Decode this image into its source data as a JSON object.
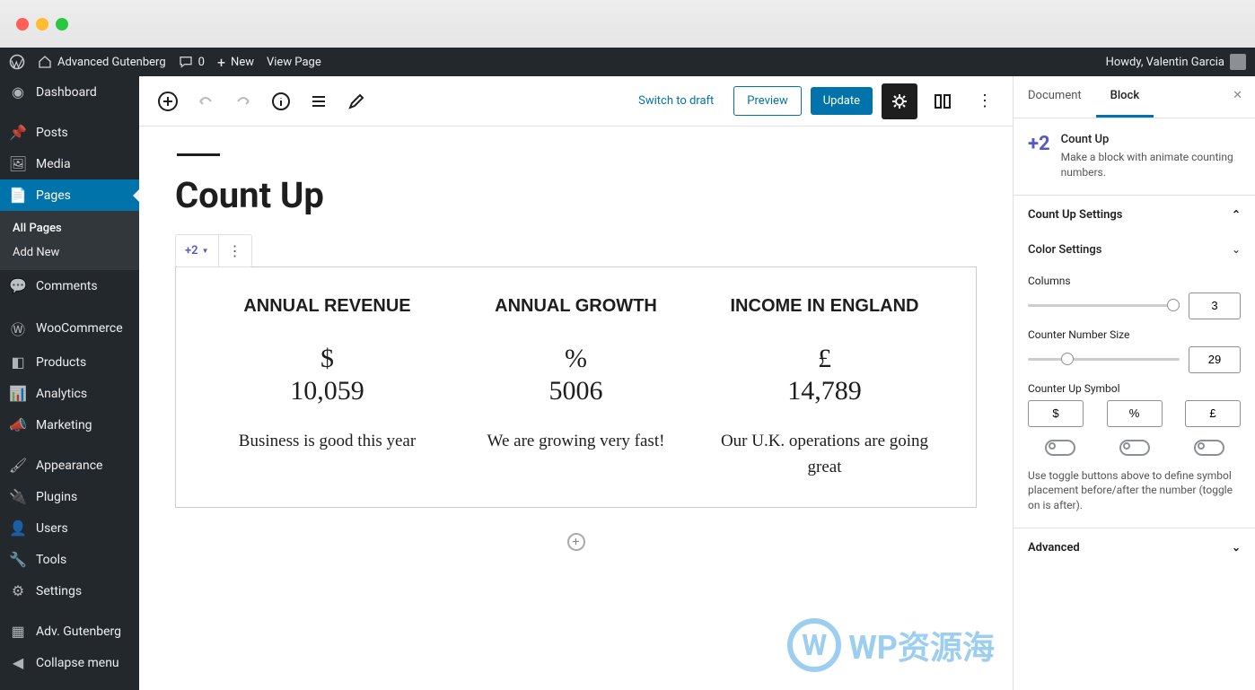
{
  "adminbar": {
    "site_name": "Advanced Gutenberg",
    "comments": "0",
    "new": "New",
    "view_page": "View Page",
    "howdy": "Howdy, Valentin Garcia"
  },
  "sidebar": {
    "items": [
      {
        "label": "Dashboard"
      },
      {
        "label": "Posts"
      },
      {
        "label": "Media"
      },
      {
        "label": "Pages"
      },
      {
        "label": "Comments"
      },
      {
        "label": "WooCommerce"
      },
      {
        "label": "Products"
      },
      {
        "label": "Analytics"
      },
      {
        "label": "Marketing"
      },
      {
        "label": "Appearance"
      },
      {
        "label": "Plugins"
      },
      {
        "label": "Users"
      },
      {
        "label": "Tools"
      },
      {
        "label": "Settings"
      },
      {
        "label": "Adv. Gutenberg"
      },
      {
        "label": "Collapse menu"
      }
    ],
    "submenu": {
      "all": "All Pages",
      "add": "Add New"
    }
  },
  "toolbar": {
    "switch_draft": "Switch to draft",
    "preview": "Preview",
    "update": "Update"
  },
  "page": {
    "title": "Count Up",
    "block_icon": "+2"
  },
  "countup": {
    "cols": [
      {
        "head": "ANNUAL REVENUE",
        "sym": "$",
        "num": "10,059",
        "desc": "Business is good this year"
      },
      {
        "head": "ANNUAL GROWTH",
        "sym": "%",
        "num": "5006",
        "desc": "We are growing very fast!"
      },
      {
        "head": "INCOME IN ENGLAND",
        "sym": "£",
        "num": "14,789",
        "desc": "Our U.K. operations are going great"
      }
    ]
  },
  "inspector": {
    "tab_document": "Document",
    "tab_block": "Block",
    "block_name": "Count Up",
    "block_desc": "Make a block with animate counting numbers.",
    "panel_settings": "Count Up Settings",
    "panel_color": "Color Settings",
    "columns_label": "Columns",
    "columns_value": "3",
    "counter_size_label": "Counter Number Size",
    "counter_size_value": "29",
    "symbol_label": "Counter Up Symbol",
    "symbols": [
      "$",
      "%",
      "£"
    ],
    "toggle_help": "Use toggle buttons above to define symbol placement before/after the number (toggle on is after).",
    "panel_advanced": "Advanced"
  },
  "watermark": "WP资源海"
}
